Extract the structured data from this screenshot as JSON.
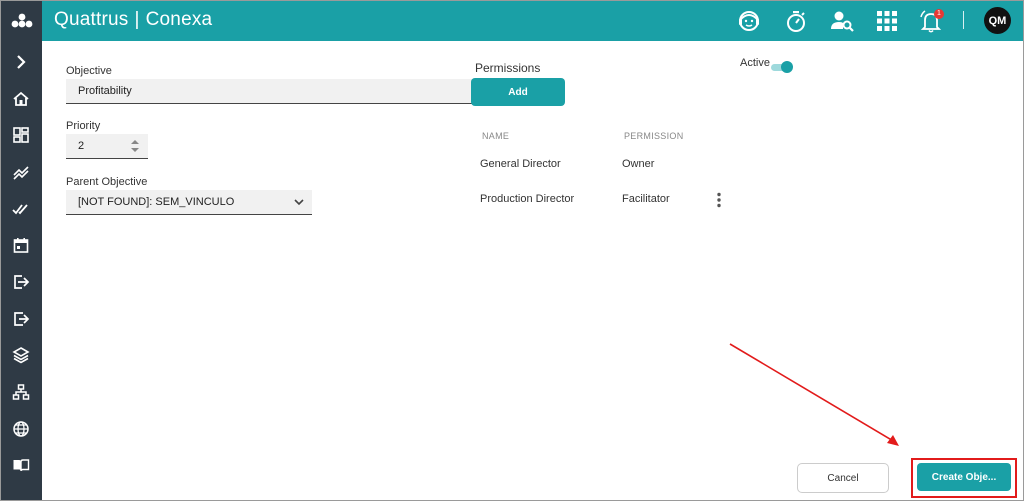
{
  "header": {
    "brand_left": "Quattrus",
    "brand_separator": "|",
    "brand_right": "Conexa",
    "notification_count": "1",
    "user_initials": "QM",
    "icons": [
      "support-agent-icon",
      "timer-icon",
      "user-search-icon",
      "apps-grid-icon",
      "notifications-icon"
    ]
  },
  "sidebar": {
    "logo_icon": "dots-cluster-logo-icon",
    "items": [
      {
        "icon": "expand-chevron-icon"
      },
      {
        "icon": "home-icon"
      },
      {
        "icon": "dashboard-icon"
      },
      {
        "icon": "trend-icon"
      },
      {
        "icon": "double-check-icon"
      },
      {
        "icon": "calendar-icon"
      },
      {
        "icon": "login-icon"
      },
      {
        "icon": "logout-icon"
      },
      {
        "icon": "layers-icon"
      },
      {
        "icon": "hierarchy-icon"
      },
      {
        "icon": "globe-icon"
      },
      {
        "icon": "book-icon"
      }
    ]
  },
  "form": {
    "objective_label": "Objective",
    "objective_value": "Profitability",
    "priority_label": "Priority",
    "priority_value": "2",
    "parent_label": "Parent Objective",
    "parent_value": "[NOT FOUND]: SEM_VINCULO"
  },
  "permissions": {
    "title": "Permissions",
    "add_label": "Add",
    "columns": [
      "NAME",
      "PERMISSION"
    ],
    "rows": [
      {
        "name": "General Director",
        "permission": "Owner"
      },
      {
        "name": "Production Director",
        "permission": "Facilitator"
      }
    ]
  },
  "active": {
    "label": "Active",
    "on": true
  },
  "footer": {
    "cancel_label": "Cancel",
    "create_label": "Create Obje..."
  },
  "colors": {
    "accent": "#1aa0a6",
    "sidebar": "#2f3a45",
    "highlight": "#e21b1b"
  }
}
